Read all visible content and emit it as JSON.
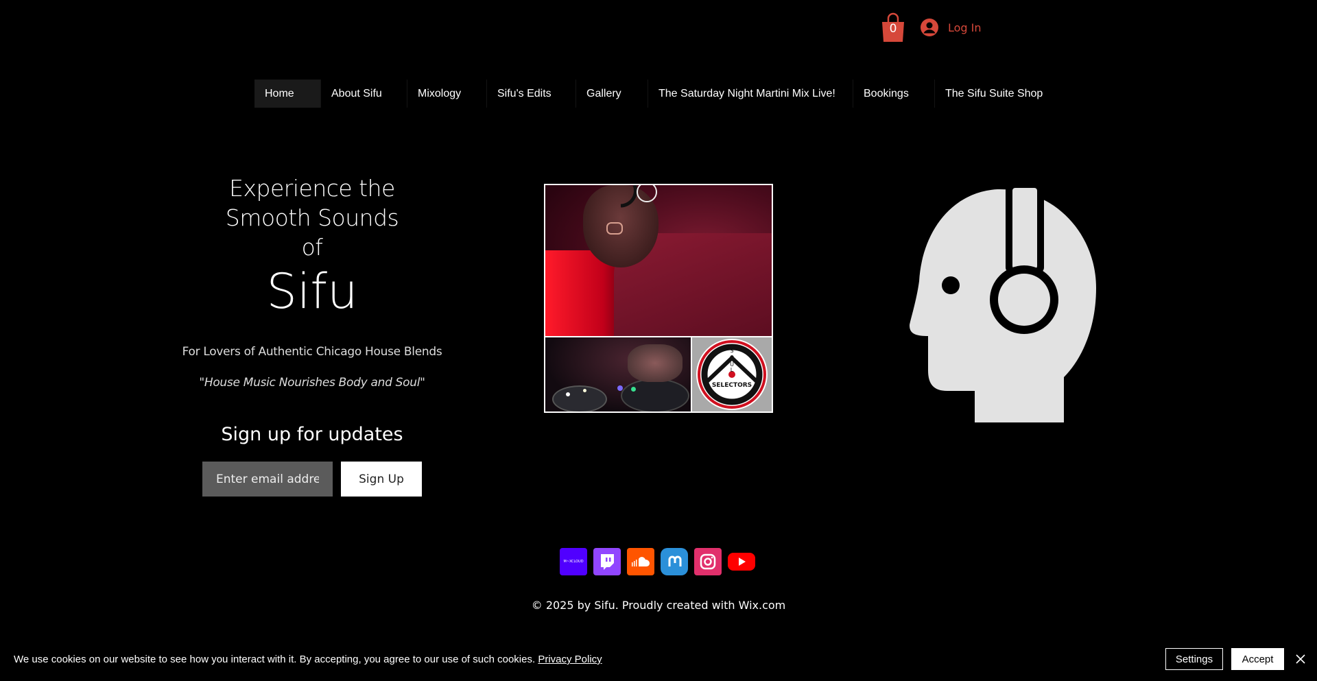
{
  "header": {
    "cart_count": "0",
    "login_label": "Log In",
    "accent_color": "#d6483a"
  },
  "nav": {
    "items": [
      {
        "label": "Home",
        "active": true
      },
      {
        "label": "About Sifu"
      },
      {
        "label": "Mixology"
      },
      {
        "label": "Sifu's Edits"
      },
      {
        "label": "Gallery"
      },
      {
        "label": "The Saturday Night Martini Mix Live!"
      },
      {
        "label": "Bookings"
      },
      {
        "label": "The Sifu Suite Shop"
      }
    ]
  },
  "hero": {
    "title_line1": "Experience the",
    "title_line2": "Smooth Sounds",
    "title_line3": "of",
    "name": "Sifu",
    "tagline": "For Lovers of Authentic Chicago House Blends",
    "quote": "\"House Music Nourishes Body and Soul\""
  },
  "signup": {
    "title": "Sign up for updates",
    "email_placeholder": "Enter email address",
    "button_label": "Sign Up"
  },
  "collage": {
    "logo_text_vertical": "SOUL",
    "logo_text_arc": "SELECTORS"
  },
  "social": {
    "icons": [
      {
        "name": "mixcloud-icon",
        "text": "M~XCLOUD",
        "color": "#5000ff"
      },
      {
        "name": "twitch-icon",
        "color": "#9146ff"
      },
      {
        "name": "soundcloud-icon",
        "color": "#ff5500"
      },
      {
        "name": "mastodon-icon",
        "color": "#2b90d9"
      },
      {
        "name": "instagram-icon",
        "color": "#e1306c"
      },
      {
        "name": "youtube-icon",
        "color": "#ff0000"
      }
    ]
  },
  "footer": {
    "copyright": "© 2025 by Sifu. Proudly created with Wix.com"
  },
  "cookie": {
    "message": "We use cookies on our website to see how you interact with it. By accepting, you agree to our use of such cookies.",
    "policy_link": "Privacy Policy",
    "settings_label": "Settings",
    "accept_label": "Accept"
  }
}
